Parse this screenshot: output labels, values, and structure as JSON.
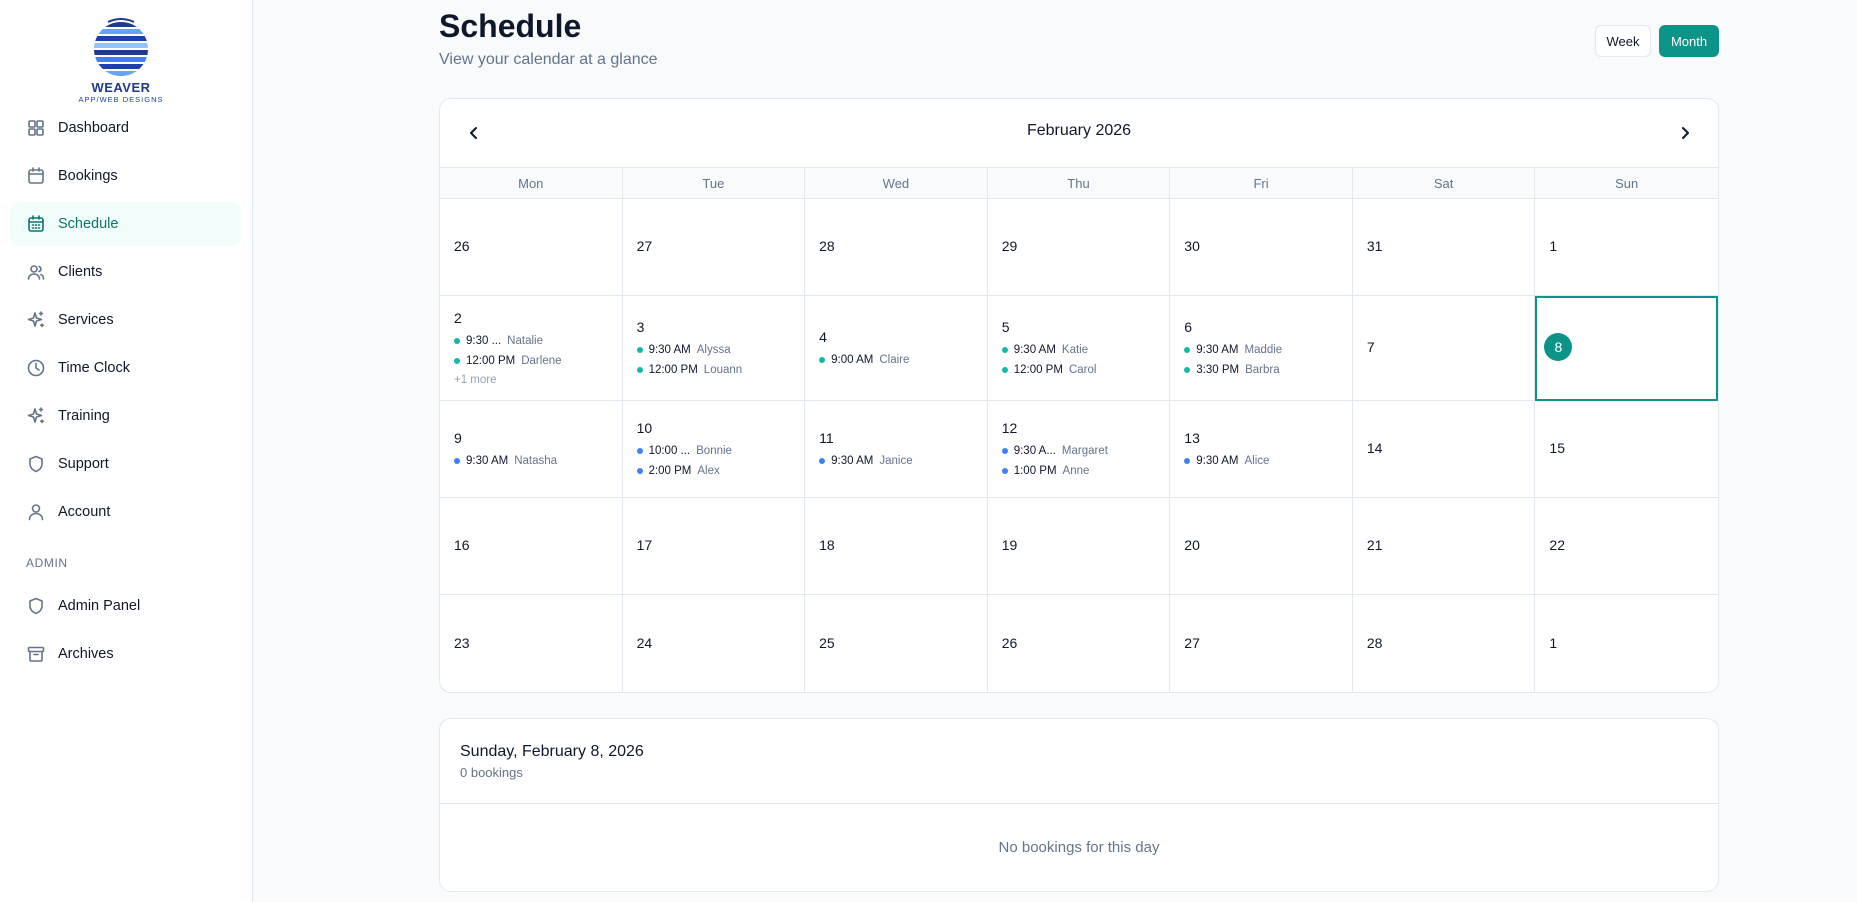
{
  "brand": {
    "name": "WEAVER",
    "tagline": "APP/WEB DESIGNS"
  },
  "sidebar": {
    "items": [
      {
        "label": "Dashboard",
        "icon": "grid-icon",
        "active": false
      },
      {
        "label": "Bookings",
        "icon": "calendar-icon",
        "active": false
      },
      {
        "label": "Schedule",
        "icon": "calendar-days-icon",
        "active": true
      },
      {
        "label": "Clients",
        "icon": "users-icon",
        "active": false
      },
      {
        "label": "Services",
        "icon": "sparkles-icon",
        "active": false
      },
      {
        "label": "Time Clock",
        "icon": "clock-icon",
        "active": false
      },
      {
        "label": "Training",
        "icon": "sparkles-icon",
        "active": false
      },
      {
        "label": "Support",
        "icon": "shield-icon",
        "active": false
      },
      {
        "label": "Account",
        "icon": "user-icon",
        "active": false
      }
    ],
    "admin_label": "ADMIN",
    "admin_items": [
      {
        "label": "Admin Panel",
        "icon": "shield-icon"
      },
      {
        "label": "Archives",
        "icon": "archive-icon"
      }
    ]
  },
  "header": {
    "title": "Schedule",
    "subtitle": "View your calendar at a glance",
    "week_label": "Week",
    "month_label": "Month",
    "active_view": "Month"
  },
  "calendar": {
    "month_label": "February 2026",
    "weekdays": [
      "Mon",
      "Tue",
      "Wed",
      "Thu",
      "Fri",
      "Sat",
      "Sun"
    ],
    "accent": "#0d9488",
    "event_colors": {
      "teal": "#14b8a6",
      "blue": "#3b82f6"
    },
    "weeks": [
      [
        {
          "day": "26",
          "events": []
        },
        {
          "day": "27",
          "events": []
        },
        {
          "day": "28",
          "events": []
        },
        {
          "day": "29",
          "events": []
        },
        {
          "day": "30",
          "events": []
        },
        {
          "day": "31",
          "events": []
        },
        {
          "day": "1",
          "events": []
        }
      ],
      [
        {
          "day": "2",
          "events": [
            {
              "time": "9:30 ...",
              "name": "Natalie",
              "color": "teal"
            },
            {
              "time": "12:00 PM",
              "name": "Darlene",
              "color": "teal"
            }
          ],
          "more": "+1 more"
        },
        {
          "day": "3",
          "events": [
            {
              "time": "9:30 AM",
              "name": "Alyssa",
              "color": "teal"
            },
            {
              "time": "12:00 PM",
              "name": "Louann",
              "color": "teal"
            }
          ]
        },
        {
          "day": "4",
          "events": [
            {
              "time": "9:00 AM",
              "name": "Claire",
              "color": "teal"
            }
          ]
        },
        {
          "day": "5",
          "events": [
            {
              "time": "9:30 AM",
              "name": "Katie",
              "color": "teal"
            },
            {
              "time": "12:00 PM",
              "name": "Carol",
              "color": "teal"
            }
          ]
        },
        {
          "day": "6",
          "events": [
            {
              "time": "9:30 AM",
              "name": "Maddie",
              "color": "teal"
            },
            {
              "time": "3:30 PM",
              "name": "Barbra",
              "color": "teal"
            }
          ]
        },
        {
          "day": "7",
          "events": []
        },
        {
          "day": "8",
          "events": [],
          "today": true,
          "selected": true
        }
      ],
      [
        {
          "day": "9",
          "events": [
            {
              "time": "9:30 AM",
              "name": "Natasha",
              "color": "blue"
            }
          ]
        },
        {
          "day": "10",
          "events": [
            {
              "time": "10:00 ...",
              "name": "Bonnie",
              "color": "blue"
            },
            {
              "time": "2:00 PM",
              "name": "Alex",
              "color": "blue"
            }
          ]
        },
        {
          "day": "11",
          "events": [
            {
              "time": "9:30 AM",
              "name": "Janice",
              "color": "blue"
            }
          ]
        },
        {
          "day": "12",
          "events": [
            {
              "time": "9:30 A...",
              "name": "Margaret",
              "color": "blue"
            },
            {
              "time": "1:00 PM",
              "name": "Anne",
              "color": "blue"
            }
          ]
        },
        {
          "day": "13",
          "events": [
            {
              "time": "9:30 AM",
              "name": "Alice",
              "color": "blue"
            }
          ]
        },
        {
          "day": "14",
          "events": []
        },
        {
          "day": "15",
          "events": []
        }
      ],
      [
        {
          "day": "16",
          "events": []
        },
        {
          "day": "17",
          "events": []
        },
        {
          "day": "18",
          "events": []
        },
        {
          "day": "19",
          "events": []
        },
        {
          "day": "20",
          "events": []
        },
        {
          "day": "21",
          "events": []
        },
        {
          "day": "22",
          "events": []
        }
      ],
      [
        {
          "day": "23",
          "events": []
        },
        {
          "day": "24",
          "events": []
        },
        {
          "day": "25",
          "events": []
        },
        {
          "day": "26",
          "events": []
        },
        {
          "day": "27",
          "events": []
        },
        {
          "day": "28",
          "events": []
        },
        {
          "day": "1",
          "events": []
        }
      ]
    ]
  },
  "day_detail": {
    "title": "Sunday, February 8, 2026",
    "count": "0 bookings",
    "empty_text": "No bookings for this day"
  }
}
